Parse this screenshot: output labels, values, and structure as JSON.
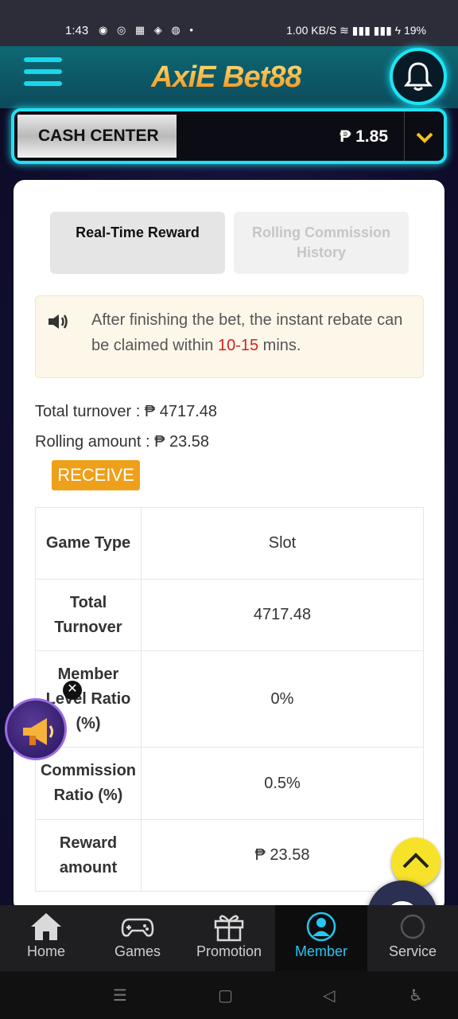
{
  "status_bar": {
    "time": "1:43",
    "notification_icons": "◉ ◎ ▦ ◈ ◍ •",
    "right": "1.00 KB/S  ≋  ▮▮▮  ▮▮▮  ϟ 19%"
  },
  "header": {
    "logo_text": "AxiE Bet88"
  },
  "cash_center": {
    "label": "CASH CENTER",
    "amount": "₱ 1.85"
  },
  "tabs": {
    "active": "Real-Time Reward",
    "inactive": "Rolling Commission History"
  },
  "notice": {
    "text_before": "After finishing the bet, the instant rebate can be claimed within ",
    "highlight": "10-15",
    "text_after": " mins."
  },
  "stats": {
    "total_turnover": "Total turnover :  ₱ 4717.48",
    "rolling_amount": "Rolling amount :  ₱ 23.58"
  },
  "receive_label": "RECEIVE",
  "table": {
    "rows": [
      {
        "label": "Game Type",
        "value": "Slot"
      },
      {
        "label": "Total Turnover",
        "value": "4717.48"
      },
      {
        "label": "Member Level Ratio (%)",
        "value": "0%"
      },
      {
        "label": "Commission Ratio (%)",
        "value": "0.5%"
      },
      {
        "label": "Reward amount",
        "value": "₱ 23.58"
      }
    ]
  },
  "bottom_nav": {
    "home": "Home",
    "games": "Games",
    "promotion": "Promotion",
    "member": "Member",
    "service": "Service"
  },
  "close_glyph": "✕",
  "colors": {
    "accent_cyan": "#23e0f2",
    "receive_orange": "#eea01a",
    "highlight_red": "#d42020",
    "active_nav": "#27c6f0"
  }
}
